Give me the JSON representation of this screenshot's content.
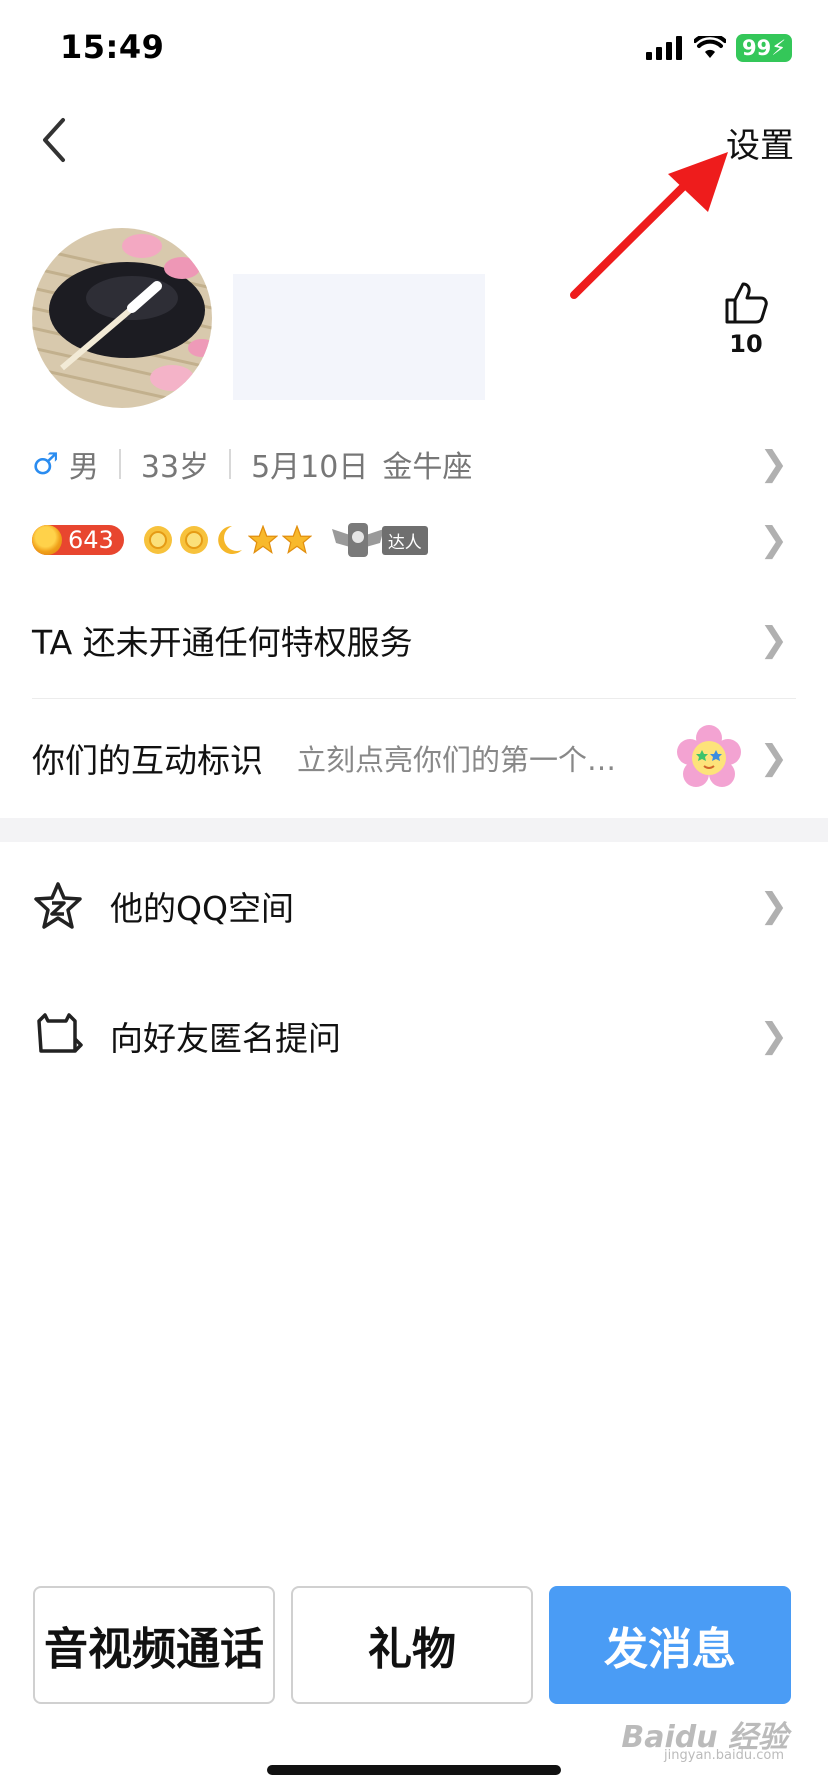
{
  "status_bar": {
    "time": "15:49",
    "battery": "99"
  },
  "nav": {
    "settings_label": "设置"
  },
  "profile": {
    "like_count": "10"
  },
  "info": {
    "gender_symbol": "♂",
    "gender": "男",
    "age": "33岁",
    "birthday": "5月10日",
    "zodiac": "金牛座"
  },
  "badges": {
    "level_number": "643",
    "daren_label": "达人"
  },
  "privilege": {
    "text": "TA 还未开通任何特权服务"
  },
  "interaction": {
    "label": "你们的互动标识",
    "hint": "立刻点亮你们的第一个…"
  },
  "menu": [
    {
      "label": "他的QQ空间",
      "icon": "qzone-star-icon"
    },
    {
      "label": "向好友匿名提问",
      "icon": "anonymous-question-icon"
    }
  ],
  "actions": {
    "call_label": "音视频通话",
    "gift_label": "礼物",
    "message_label": "发消息"
  },
  "watermark": {
    "text": "Baidu 经验",
    "sub": "jingyan.baidu.com"
  },
  "colors": {
    "accent": "#4a9cf5",
    "annotation_arrow": "#ee1c1c",
    "gender": "#2a8cf0",
    "battery": "#34c759"
  }
}
